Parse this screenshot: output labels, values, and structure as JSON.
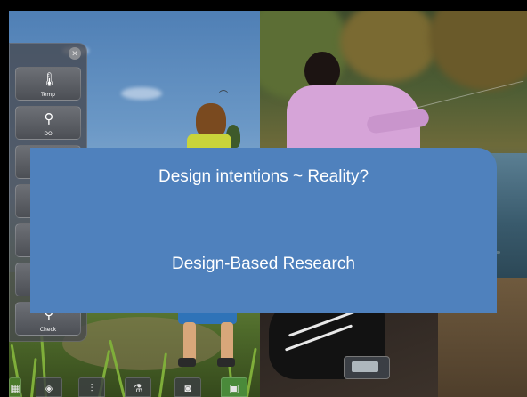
{
  "overlay": {
    "title": "Design intentions ~ Reality?",
    "subtitle": "Design-Based Research"
  },
  "tool_dock": {
    "close_icon": "close-icon",
    "tiles": [
      {
        "icon": "thermometer-icon",
        "label": "Temp"
      },
      {
        "icon": "dissolved-oxygen-probe-icon",
        "label": "DO"
      },
      {
        "icon": "tool-icon",
        "label": ""
      },
      {
        "icon": "tool-icon",
        "label": ""
      },
      {
        "icon": "tool-icon",
        "label": ""
      },
      {
        "icon": "tool-icon",
        "label": ""
      },
      {
        "icon": "probe-icon",
        "label": "Check"
      }
    ]
  },
  "inventory": [
    {
      "icon": "map-icon"
    },
    {
      "icon": "globe-icon"
    },
    {
      "icon": "test-tubes-icon"
    },
    {
      "icon": "microscope-icon"
    },
    {
      "icon": "camera-icon"
    },
    {
      "icon": "notebook-icon"
    }
  ],
  "colors": {
    "overlay": "#4f81bd",
    "overlay_text": "#ffffff",
    "background": "#000000"
  }
}
